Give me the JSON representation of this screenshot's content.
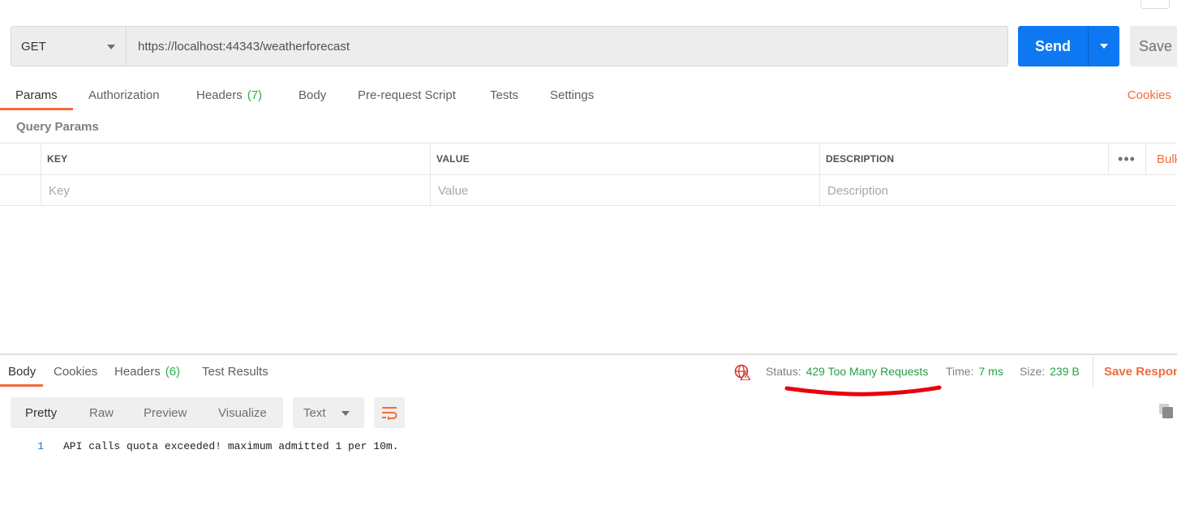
{
  "request": {
    "method": "GET",
    "url": "https://localhost:44343/weatherforecast",
    "send_label": "Send",
    "save_label": "Save"
  },
  "request_tabs": [
    {
      "label": "Params",
      "active": true
    },
    {
      "label": "Authorization"
    },
    {
      "label": "Headers",
      "count": "(7)"
    },
    {
      "label": "Body"
    },
    {
      "label": "Pre-request Script"
    },
    {
      "label": "Tests"
    },
    {
      "label": "Settings"
    }
  ],
  "cookies_label": "Cookies",
  "query_params": {
    "title": "Query Params",
    "columns": [
      "KEY",
      "VALUE",
      "DESCRIPTION"
    ],
    "bulk_label": "Bulk",
    "placeholders": {
      "key": "Key",
      "value": "Value",
      "description": "Description"
    }
  },
  "response_tabs": [
    {
      "label": "Body",
      "active": true
    },
    {
      "label": "Cookies"
    },
    {
      "label": "Headers",
      "count": "(6)"
    },
    {
      "label": "Test Results"
    }
  ],
  "response_meta": {
    "status_label": "Status:",
    "status_value": "429 Too Many Requests",
    "time_label": "Time:",
    "time_value": "7 ms",
    "size_label": "Size:",
    "size_value": "239 B",
    "save_response_label": "Save Respon"
  },
  "view_modes": [
    "Pretty",
    "Raw",
    "Preview",
    "Visualize"
  ],
  "format": "Text",
  "response_body": [
    {
      "line": "1",
      "text": "API calls quota exceeded! maximum admitted 1 per 10m."
    }
  ],
  "colors": {
    "accent": "#f26b3a",
    "send": "#0d78f2",
    "status_ok": "#26a047",
    "annotation": "#e8000b"
  },
  "icons": {
    "globe": "globe-warning-icon",
    "wrap": "word-wrap-icon",
    "copy": "copy-icon"
  }
}
